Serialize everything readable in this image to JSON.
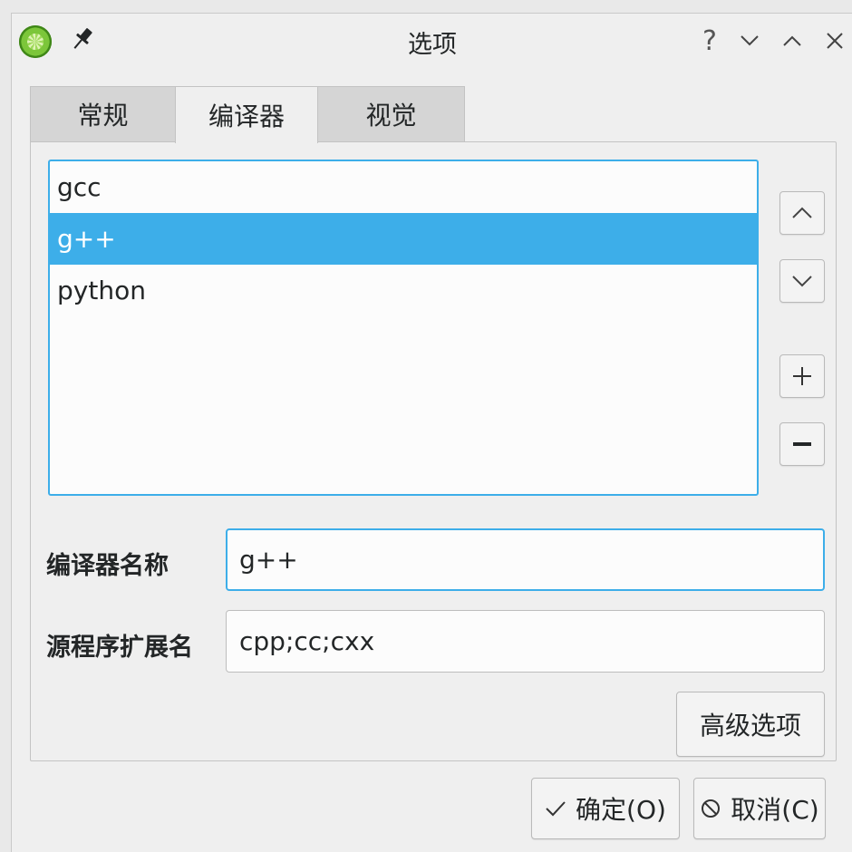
{
  "window": {
    "title": "选项",
    "help_glyph": "?",
    "icons": [
      "app-icon",
      "pin-icon",
      "help-icon",
      "minimize-icon",
      "maximize-icon",
      "close-icon"
    ]
  },
  "tabs": [
    {
      "label": "常规",
      "active": false
    },
    {
      "label": "编译器",
      "active": true
    },
    {
      "label": "视觉",
      "active": false
    }
  ],
  "compilers": {
    "items": [
      "gcc",
      "g++",
      "python"
    ],
    "selected": "g++"
  },
  "side_buttons": [
    "move-up",
    "move-down",
    "add",
    "remove"
  ],
  "form": {
    "name_label": "编译器名称",
    "name_value": "g++",
    "ext_label": "源程序扩展名",
    "ext_value": "cpp;cc;cxx",
    "advanced_label": "高级选项"
  },
  "footer": {
    "ok_label": "确定(O)",
    "cancel_label": "取消(C)"
  },
  "colors": {
    "accent": "#3daee9",
    "window_bg": "#efefef",
    "text": "#232627"
  }
}
